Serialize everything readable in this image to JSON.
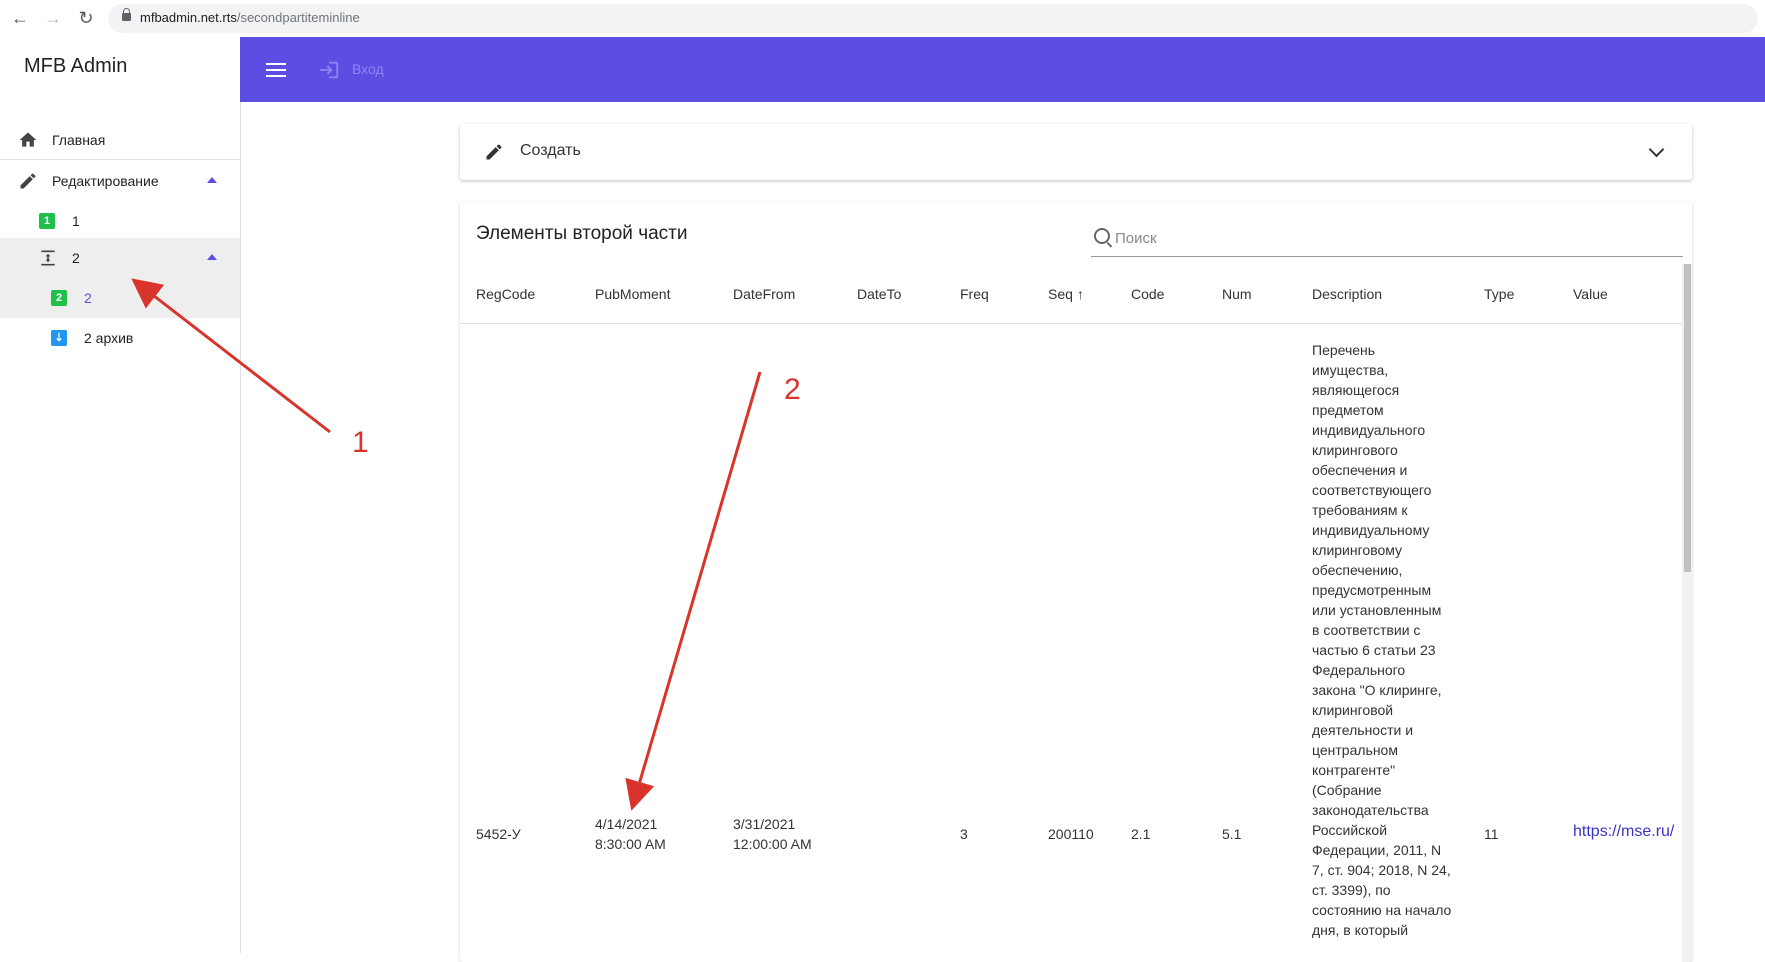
{
  "browser": {
    "url_host": "mfbadmin.net.rts",
    "url_path": "/secondpartiteminline"
  },
  "sidebar": {
    "app_title": "MFB Admin",
    "items": [
      {
        "label": "Главная",
        "icon": "home-icon"
      },
      {
        "label": "Редактирование",
        "icon": "pencil-icon"
      },
      {
        "label": "1",
        "icon": "badge-1-icon",
        "badge": "1",
        "badge_color": "#1fbf4a"
      },
      {
        "label": "2",
        "icon": "vertical-align-icon"
      },
      {
        "label": "2",
        "icon": "badge-2-icon",
        "badge": "2",
        "badge_color": "#1fbf4a"
      },
      {
        "label": "2 архив",
        "icon": "archive-icon",
        "badge_color": "#2196f3"
      }
    ]
  },
  "appbar": {
    "login_label": "Вход",
    "color": "#5c4ee3"
  },
  "create_panel": {
    "label": "Создать"
  },
  "table": {
    "title": "Элементы второй части",
    "search_placeholder": "Поиск",
    "columns": [
      "RegCode",
      "PubMoment",
      "DateFrom",
      "DateTo",
      "Freq",
      "Seq",
      "Code",
      "Num",
      "Description",
      "Type",
      "Value"
    ],
    "sort_indicator": "↑",
    "row": {
      "RegCode": "5452-У",
      "PubMoment_date": "4/14/2021",
      "PubMoment_time": "8:30:00 AM",
      "DateFrom_date": "3/31/2021",
      "DateFrom_time": "12:00:00 AM",
      "DateTo": "",
      "Freq": "3",
      "Seq": "200110",
      "Code": "2.1",
      "Num": "5.1",
      "Description": "Перечень имущества, являющегося предметом индивидуального клирингового обеспечения и соответствующего требованиям к индивидуальному клиринговому обеспечению, предусмотренным или установленным в соответствии с частью 6 статьи 23 Федерального закона \"О клиринге, клиринговой деятельности и центральном контрагенте\" (Собрание законодательства Российской Федерации, 2011, N 7, ст. 904; 2018, N 24, ст. 3399), по состоянию на начало дня, в который",
      "Type": "11",
      "Value": "https://mse.ru/"
    }
  },
  "annotations": {
    "label_1": "1",
    "label_2": "2",
    "color": "#d9342b"
  }
}
